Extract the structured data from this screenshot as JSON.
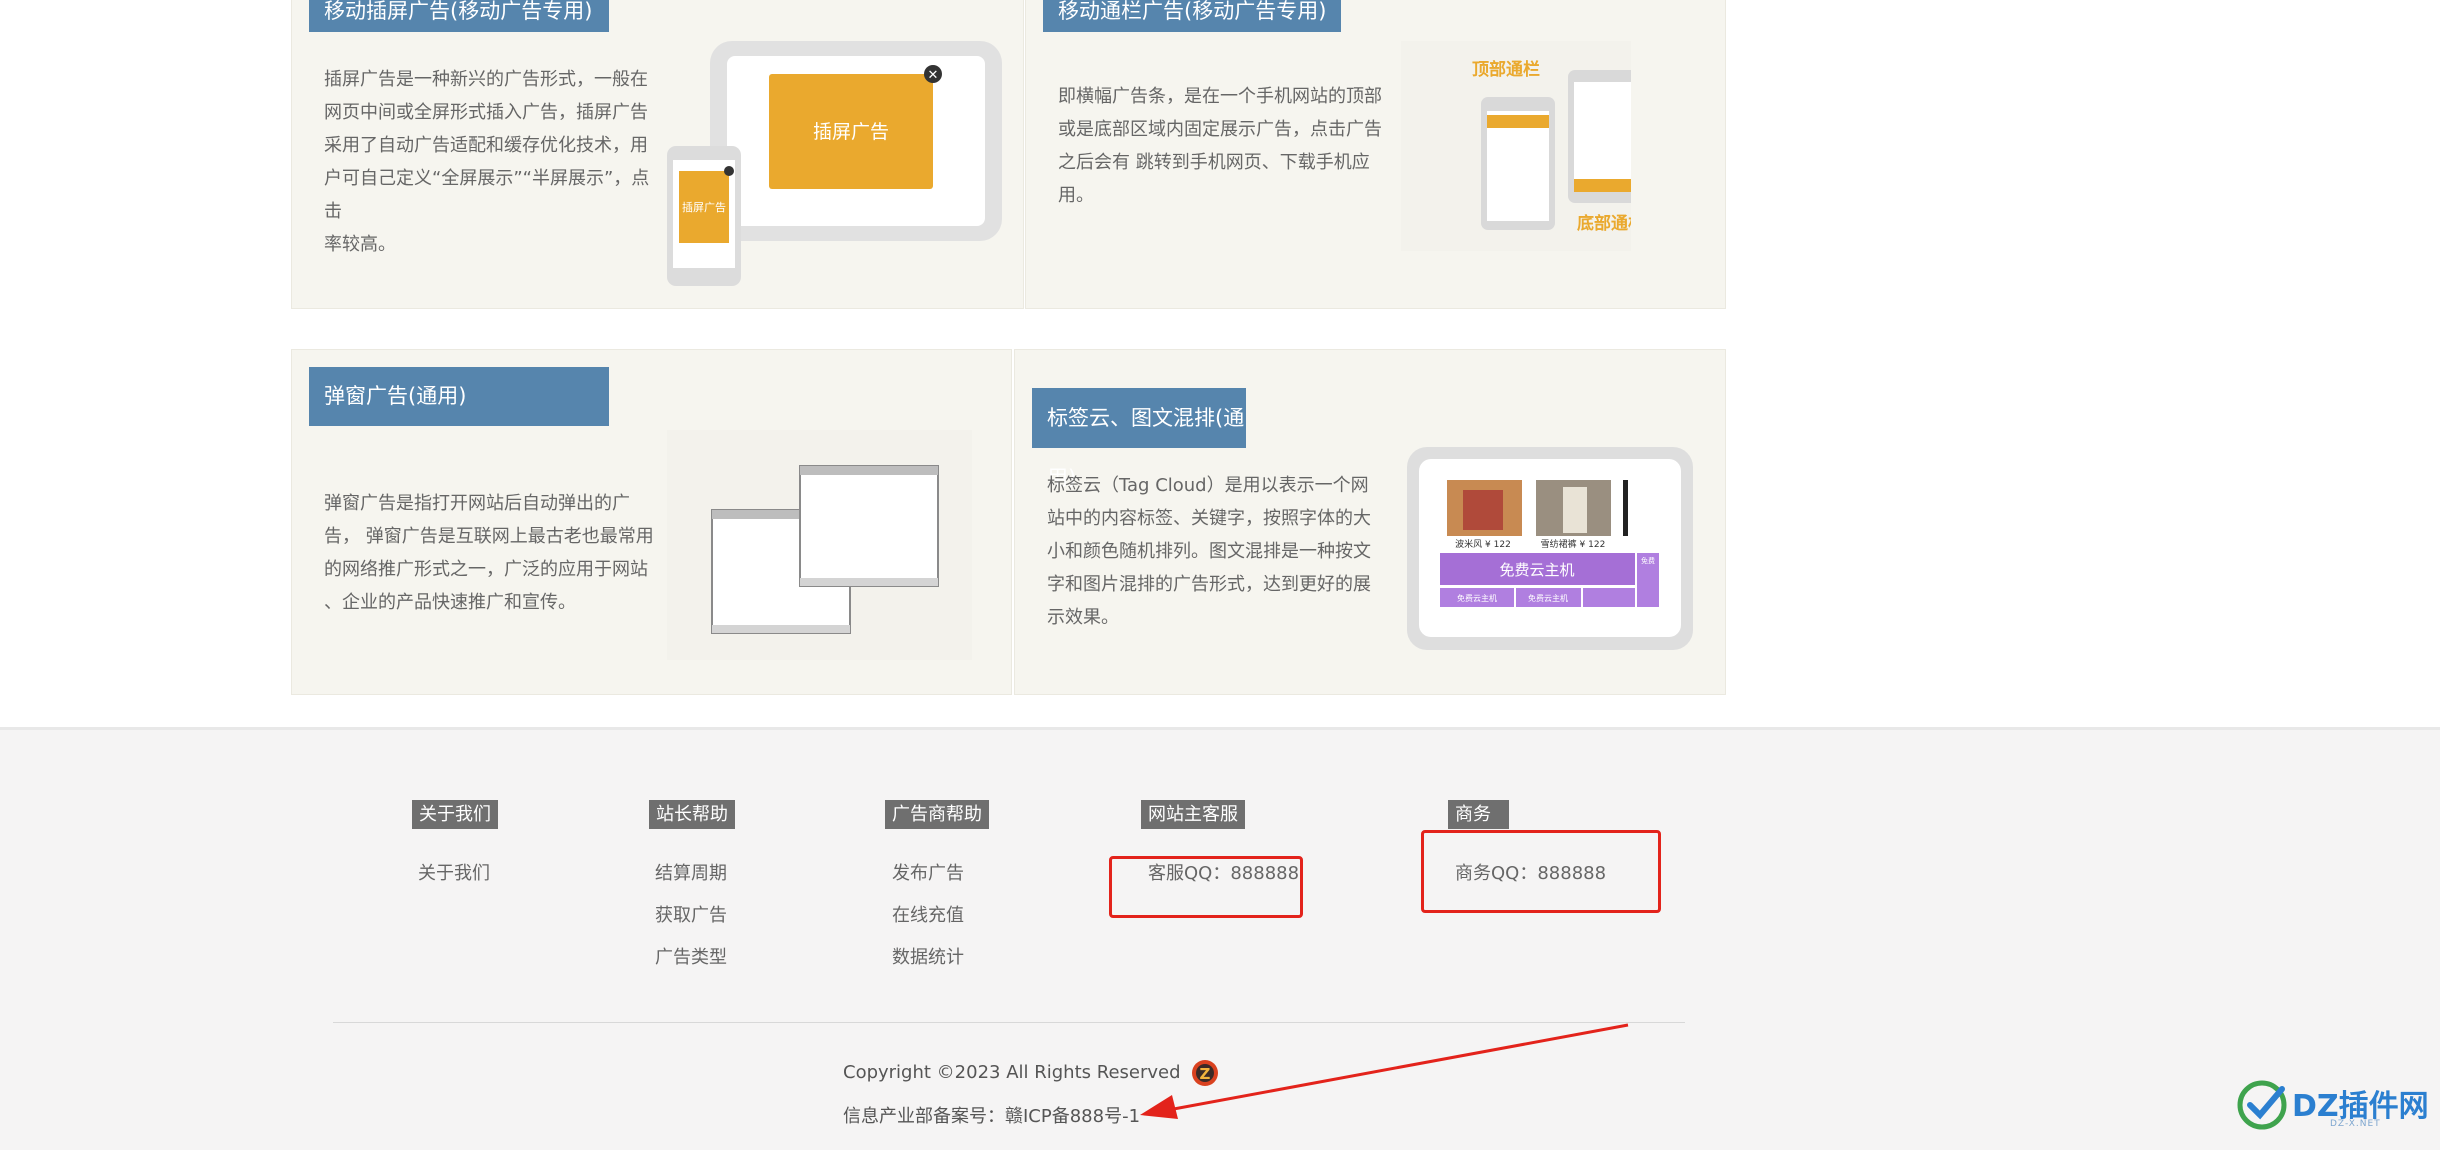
{
  "cards": [
    {
      "title": "移动插屏广告(移动广告专用)",
      "desc_lines": [
        "插屏广告是一种新兴的广告形式，一般在",
        "网页中间或全屏形式插入广告，插屏广告",
        "采用了自动广告适配和缓存优化技术，用",
        "户可自己定义“全屏展示”“半屏展示”，点击",
        "率较高。"
      ],
      "illus_label": "插屏广告",
      "illus_small_label": "插屏广告"
    },
    {
      "title": "移动通栏广告(移动广告专用)",
      "desc_lines": [
        "即横幅广告条，是在一个手机网站的顶部",
        "或是底部区域内固定展示广告，点击广告",
        "之后会有 跳转到手机网页、下载手机应",
        "用。"
      ],
      "illus_top_label": "顶部通栏",
      "illus_bottom_label": "底部通栏"
    },
    {
      "title": "弹窗广告(通用)",
      "desc_lines": [
        "弹窗广告是指打开网站后自动弹出的广",
        "告， 弹窗广告是互联网上最古老也最常用",
        "的网络推广形式之一，广泛的应用于网站",
        "、企业的产品快速推广和宣传。"
      ]
    },
    {
      "title": "标签云、图文混排(通用)",
      "desc_lines": [
        "标签云（Tag Cloud）是用以表示一个网",
        "站中的内容标签、关键字，按照字体的大",
        "小和颜色随机排列。图文混排是一种按文",
        "字和图片混排的广告形式，达到更好的展",
        "示效果。"
      ],
      "illus_caption1": "波米风 ¥ 122",
      "illus_caption2": "雪纺裙裤 ¥ 122",
      "illus_banner": "免费云主机",
      "illus_btn1": "免费云主机",
      "illus_btn2": "免费云主机",
      "illus_side": "免费"
    }
  ],
  "footer": {
    "columns": [
      {
        "heading": "关于我们",
        "links": [
          "关于我们"
        ]
      },
      {
        "heading": "站长帮助",
        "links": [
          "结算周期",
          "获取广告",
          "广告类型"
        ]
      },
      {
        "heading": "广告商帮助",
        "links": [
          "发布广告",
          "在线充值",
          "数据统计"
        ]
      },
      {
        "heading": "网站主客服",
        "links": [
          "客服QQ：888888"
        ]
      },
      {
        "heading": "商务",
        "links": [
          "商务QQ：888888"
        ]
      }
    ],
    "copyright": "Copyright ©2023 All Rights Reserved",
    "icp": "信息产业部备案号：赣ICP备888号-1"
  },
  "watermark": {
    "text": "DZ插件网",
    "sub": "DZ-X.NET"
  },
  "colors": {
    "title_bg": "#5685ad",
    "card_bg": "#f6f5ef",
    "accent_orange": "#eaa92e",
    "annotation_red": "#e3231b",
    "purple": "#a56fd6"
  }
}
